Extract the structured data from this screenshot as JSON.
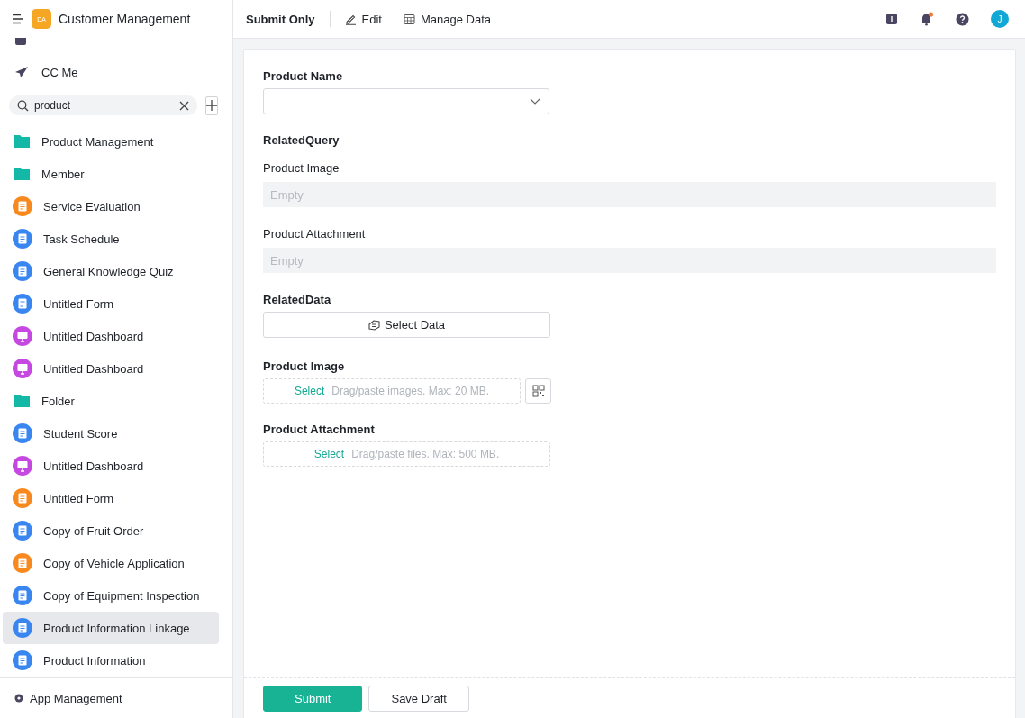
{
  "app": {
    "title": "Customer Management",
    "logo": "DA"
  },
  "nav_top": [
    {
      "kind": "inbox"
    },
    {
      "label": "CC Me",
      "kind": "send"
    }
  ],
  "search": {
    "value": "product"
  },
  "sidebar": {
    "items": [
      {
        "label": "Product Management",
        "kind": "folder",
        "color": "#14b8a6",
        "selected": false
      },
      {
        "label": "Member",
        "kind": "folder",
        "color": "#14b8a6",
        "selected": false
      },
      {
        "label": "Service Evaluation",
        "kind": "form",
        "color": "#f7891f",
        "selected": false
      },
      {
        "label": "Task Schedule",
        "kind": "form",
        "color": "#3a86f0",
        "selected": false
      },
      {
        "label": "General Knowledge Quiz",
        "kind": "form",
        "color": "#3a86f0",
        "selected": false
      },
      {
        "label": "Untitled Form",
        "kind": "form",
        "color": "#3a86f0",
        "selected": false
      },
      {
        "label": "Untitled Dashboard",
        "kind": "dashboard",
        "color": "#c548e0",
        "selected": false
      },
      {
        "label": "Untitled Dashboard",
        "kind": "dashboard",
        "color": "#c548e0",
        "selected": false
      },
      {
        "label": "Folder",
        "kind": "folder",
        "color": "#14b8a6",
        "selected": false
      },
      {
        "label": "Student Score",
        "kind": "form",
        "color": "#3a86f0",
        "selected": false
      },
      {
        "label": "Untitled Dashboard",
        "kind": "dashboard",
        "color": "#c548e0",
        "selected": false
      },
      {
        "label": "Untitled Form",
        "kind": "flow",
        "color": "#f7891f",
        "selected": false
      },
      {
        "label": "Copy of Fruit Order",
        "kind": "form",
        "color": "#3a86f0",
        "selected": false
      },
      {
        "label": "Copy of Vehicle Application",
        "kind": "flow",
        "color": "#f7891f",
        "selected": false
      },
      {
        "label": "Copy of Equipment Inspection",
        "kind": "form",
        "color": "#3a86f0",
        "selected": false
      },
      {
        "label": "Product Information Linkage",
        "kind": "form",
        "color": "#3a86f0",
        "selected": true
      },
      {
        "label": "Product Information",
        "kind": "form",
        "color": "#3a86f0",
        "selected": false
      }
    ],
    "footer": "App Management"
  },
  "toolbar": {
    "title": "Submit Only",
    "actions": [
      {
        "label": "Edit",
        "kind": "edit"
      },
      {
        "label": "Manage Data",
        "kind": "table"
      }
    ],
    "avatar": "J",
    "notification_dot": true
  },
  "form": {
    "fields": [
      {
        "kind": "select",
        "label": "Product Name"
      },
      {
        "kind": "heading",
        "label": "RelatedQuery"
      },
      {
        "kind": "readonly",
        "label": "Product Image",
        "placeholder": "Empty"
      },
      {
        "kind": "readonly",
        "label": "Product Attachment",
        "placeholder": "Empty"
      },
      {
        "kind": "picker",
        "label": "RelatedData",
        "button": "Select Data"
      },
      {
        "kind": "upload",
        "label": "Product Image",
        "action": "Select",
        "hint": "Drag/paste images. Max: 20 MB.",
        "qr": true
      },
      {
        "kind": "upload",
        "label": "Product Attachment",
        "action": "Select",
        "hint": "Drag/paste files. Max: 500 MB.",
        "qr": false
      }
    ],
    "buttons": [
      {
        "label": "Submit",
        "kind": "primary"
      },
      {
        "label": "Save Draft",
        "kind": "default"
      }
    ]
  }
}
